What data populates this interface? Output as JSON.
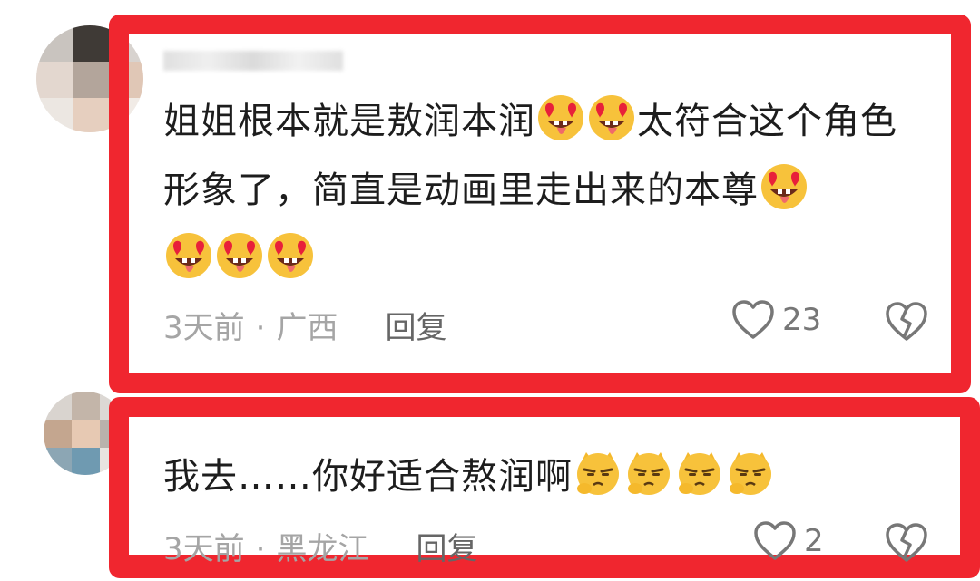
{
  "comments": [
    {
      "text_parts": [
        "姐姐根本就是敖润本润",
        "太符合这个角色形象了，简直是动画里走出来的本尊"
      ],
      "emoji_name": "heart-eyes-tongue-emoji",
      "time": "3天前",
      "separator": "·",
      "location": "广西",
      "reply_label": "回复",
      "like_count": "23"
    },
    {
      "text": "我去……你好适合熬润啊",
      "emoji_name": "smug-cat-face-emoji",
      "time": "3天前",
      "separator": "·",
      "location": "黑龙江",
      "reply_label": "回复",
      "like_count": "2"
    }
  ],
  "colors": {
    "highlight": "#f0262f",
    "meta_text": "#a5a5a5",
    "body_text": "#1d1d1d",
    "icon_gray": "#777777"
  }
}
